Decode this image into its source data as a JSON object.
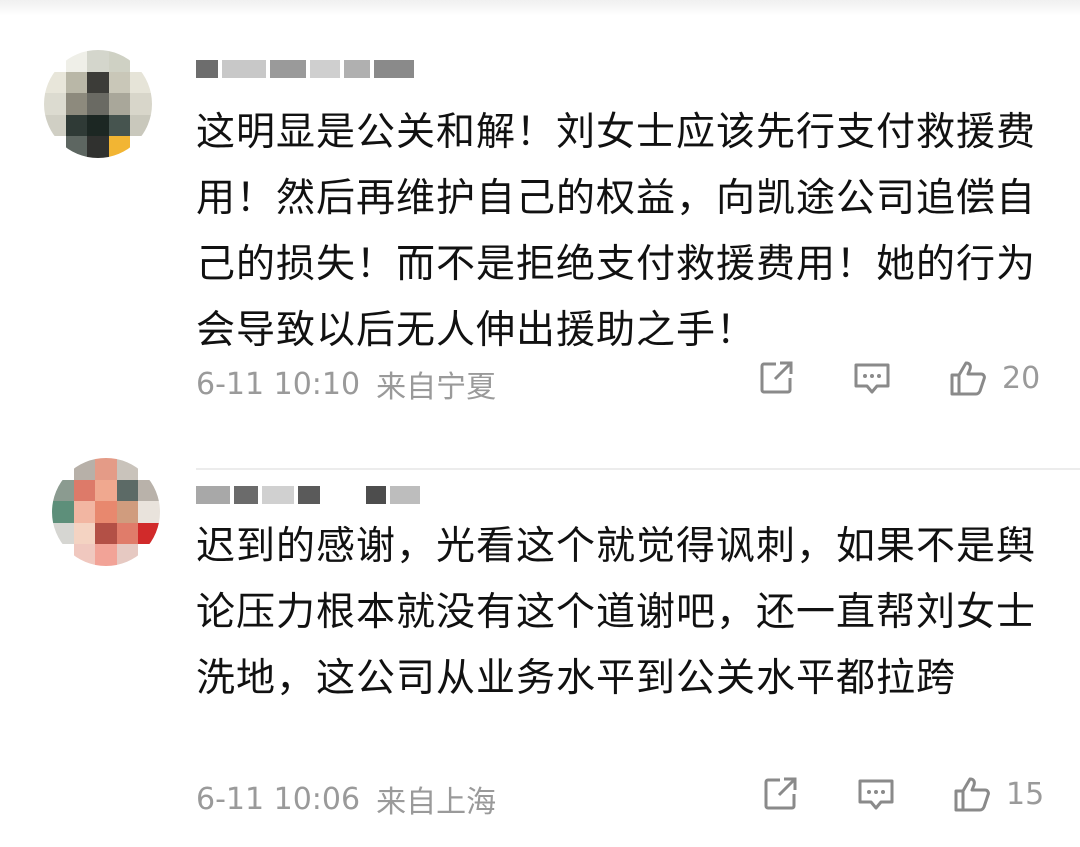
{
  "comments": [
    {
      "text": "这明显是公关和解！刘女士应该先行支付救援费用！然后再维护自己的权益，向凯途公司追偿自己的损失！而不是拒绝支付救援费用！她的行为会导致以后无人伸出援助之手！",
      "time": "6-11 10:10",
      "location": "来自宁夏",
      "likes": "20"
    },
    {
      "text": "迟到的感谢，光看这个就觉得讽刺，如果不是舆论压力根本就没有这个道谢吧，还一直帮刘女士洗地，这公司从业务水平到公关水平都拉跨",
      "time": "6-11 10:06",
      "location": "来自上海",
      "likes": "15"
    }
  ],
  "icons": {
    "share": "share-icon",
    "comment": "comment-icon",
    "like": "thumbs-up-icon"
  },
  "colors": {
    "text": "#111111",
    "meta": "#9a9a9a",
    "divider": "#ececec"
  }
}
